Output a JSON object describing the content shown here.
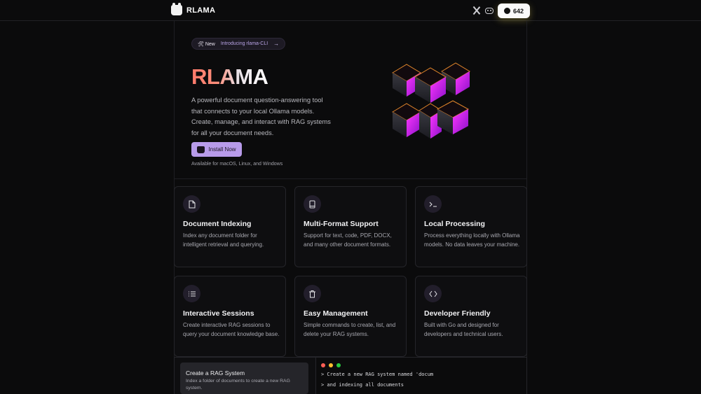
{
  "header": {
    "brand": "RLAMA",
    "github_count": "642",
    "icons": [
      "x-icon",
      "discord-icon",
      "github-icon"
    ]
  },
  "hero": {
    "pill_tag": "🛠 New",
    "pill_text": "Introducing rlama-CLI",
    "pill_arrow": "→",
    "title": "RLAMA",
    "description": "A powerful document question-answering tool that connects to your local Ollama models. Create, manage, and interact with RAG systems for all your document needs.",
    "install_label": "Install Now",
    "availability": "Available for macOS, Linux, and Windows"
  },
  "features": [
    {
      "icon": "file-icon",
      "title": "Document Indexing",
      "desc": "Index any document folder for intelligent retrieval and querying."
    },
    {
      "icon": "book-icon",
      "title": "Multi-Format Support",
      "desc": "Support for text, code, PDF, DOCX, and many other document formats."
    },
    {
      "icon": "terminal-icon",
      "title": "Local Processing",
      "desc": "Process everything locally with Ollama models. No data leaves your machine."
    },
    {
      "icon": "list-icon",
      "title": "Interactive Sessions",
      "desc": "Create interactive RAG sessions to query your document knowledge base."
    },
    {
      "icon": "trash-icon",
      "title": "Easy Management",
      "desc": "Simple commands to create, list, and delete your RAG systems."
    },
    {
      "icon": "code-icon",
      "title": "Developer Friendly",
      "desc": "Built with Go and designed for developers and technical users."
    }
  ],
  "demo": {
    "step_title": "Create a RAG System",
    "step_desc": "Index a folder of documents to create a new RAG system.",
    "terminal_lines": [
      "> Create a new RAG system named 'docum",
      "> and indexing all documents"
    ],
    "dot_colors": [
      "#ff5f56",
      "#ffbd2e",
      "#27c93f"
    ]
  }
}
